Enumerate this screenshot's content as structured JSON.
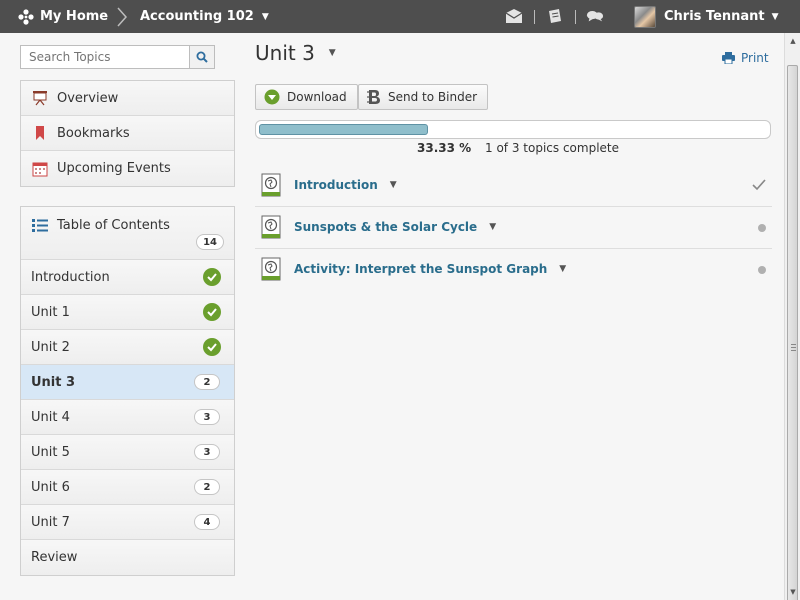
{
  "topbar": {
    "home_label": "My Home",
    "course_label": "Accounting 102",
    "user_name": "Chris Tennant",
    "icons": [
      "home-icon",
      "chevron-right-icon",
      "mail-icon",
      "updates-icon",
      "chat-icon",
      "user-avatar"
    ]
  },
  "sidebar": {
    "search_placeholder": "Search Topics",
    "nav": [
      {
        "label": "Overview",
        "icon": "overview-icon"
      },
      {
        "label": "Bookmarks",
        "icon": "bookmark-icon"
      },
      {
        "label": "Upcoming Events",
        "icon": "calendar-icon"
      }
    ],
    "toc": {
      "label": "Table of Contents",
      "count": "14",
      "items": [
        {
          "label": "Introduction",
          "status": "complete"
        },
        {
          "label": "Unit 1",
          "status": "complete"
        },
        {
          "label": "Unit 2",
          "status": "complete"
        },
        {
          "label": "Unit 3",
          "badge": "2",
          "active": true
        },
        {
          "label": "Unit 4",
          "badge": "3"
        },
        {
          "label": "Unit 5",
          "badge": "3"
        },
        {
          "label": "Unit 6",
          "badge": "2"
        },
        {
          "label": "Unit 7",
          "badge": "4"
        },
        {
          "label": "Review"
        }
      ]
    }
  },
  "main": {
    "title": "Unit 3",
    "print_label": "Print",
    "download_label": "Download",
    "binder_label": "Send to Binder",
    "progress": {
      "fraction": 0.3333,
      "percent_text": "33.33 %",
      "summary": "1 of 3 topics complete"
    },
    "topics": [
      {
        "name": "Introduction",
        "status": "complete"
      },
      {
        "name": "Sunspots & the Solar Cycle",
        "status": "incomplete"
      },
      {
        "name": "Activity: Interpret the Sunspot Graph",
        "status": "incomplete"
      }
    ]
  },
  "colors": {
    "topbar": "#4e4e4e",
    "link": "#2a6d8c",
    "active_row": "#d7e7f6",
    "check_green": "#6a9f2d",
    "progress_fill": "#8fbecb"
  }
}
